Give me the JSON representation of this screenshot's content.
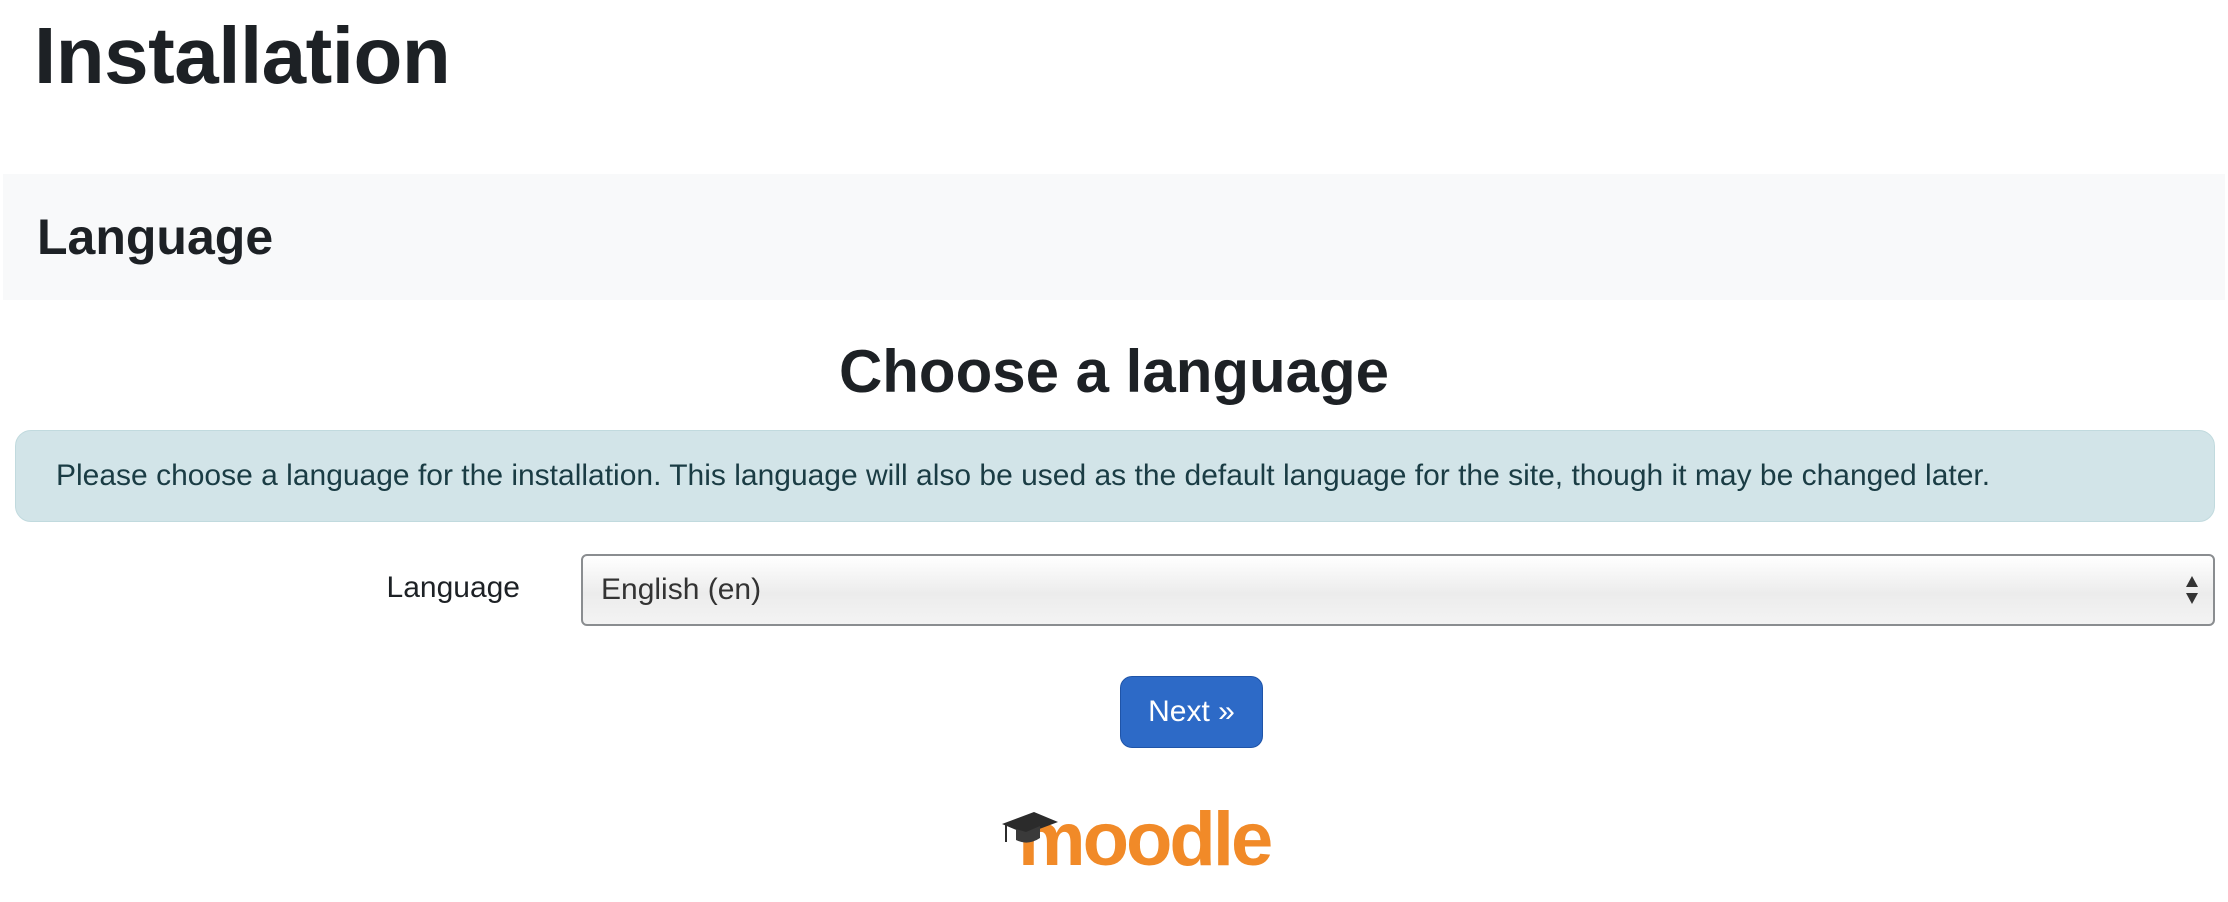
{
  "page": {
    "title": "Installation"
  },
  "section": {
    "title": "Language"
  },
  "main": {
    "heading": "Choose a language",
    "info": "Please choose a language for the installation. This language will also be used as the default language for the site, though it may be changed later."
  },
  "form": {
    "language_label": "Language",
    "language_value": "English (en)",
    "next_label": "Next »"
  },
  "logo": {
    "text": "moodle"
  },
  "colors": {
    "info_bg": "#d2e4e8",
    "button_bg": "#2d6ac7",
    "logo_orange": "#f18a28",
    "header_bg": "#f8f9fa"
  },
  "icons": {
    "select_arrows": "select-updown-icon",
    "logo_cap": "graduation-cap-icon"
  }
}
